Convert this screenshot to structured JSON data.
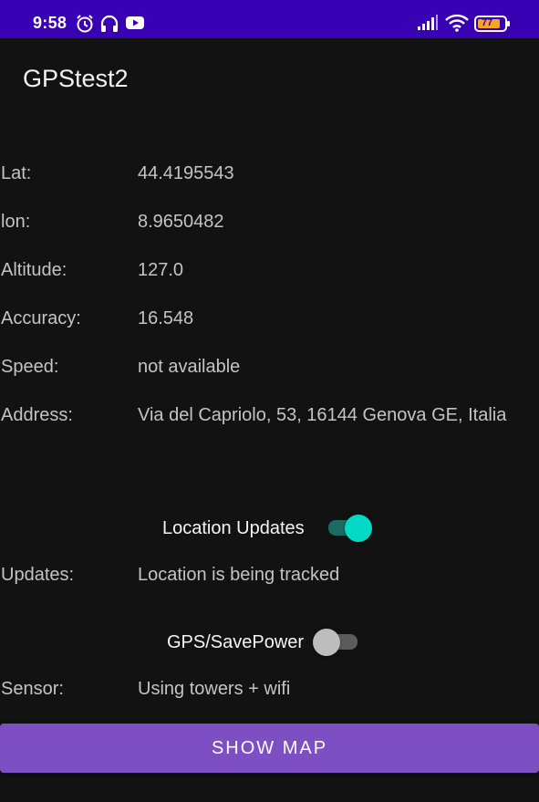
{
  "status_bar": {
    "time": "9:58",
    "battery": "77",
    "icons": [
      "alarm-icon",
      "headphones-icon",
      "youtube-icon",
      "signal-icon",
      "wifi-icon",
      "battery-icon"
    ]
  },
  "app": {
    "title": "GPStest2"
  },
  "location": {
    "lat_label": "Lat:",
    "lat_value": "44.4195543",
    "lon_label": "lon:",
    "lon_value": "8.9650482",
    "altitude_label": "Altitude:",
    "altitude_value": "127.0",
    "accuracy_label": "Accuracy:",
    "accuracy_value": "16.548",
    "speed_label": "Speed:",
    "speed_value": "not available",
    "address_label": "Address:",
    "address_value": "Via del Capriolo, 53, 16144 Genova GE, Italia"
  },
  "location_updates": {
    "label": "Location Updates",
    "on": true
  },
  "updates": {
    "label": "Updates:",
    "value": "Location is being tracked"
  },
  "gps_savepower": {
    "label": "GPS/SavePower",
    "on": false
  },
  "sensor": {
    "label": "Sensor:",
    "value": "Using towers + wifi"
  },
  "show_map": {
    "label": "SHOW MAP"
  },
  "colors": {
    "status_bar": "#3a00b3",
    "accent": "#03dac5",
    "button": "#7e4fc2"
  }
}
